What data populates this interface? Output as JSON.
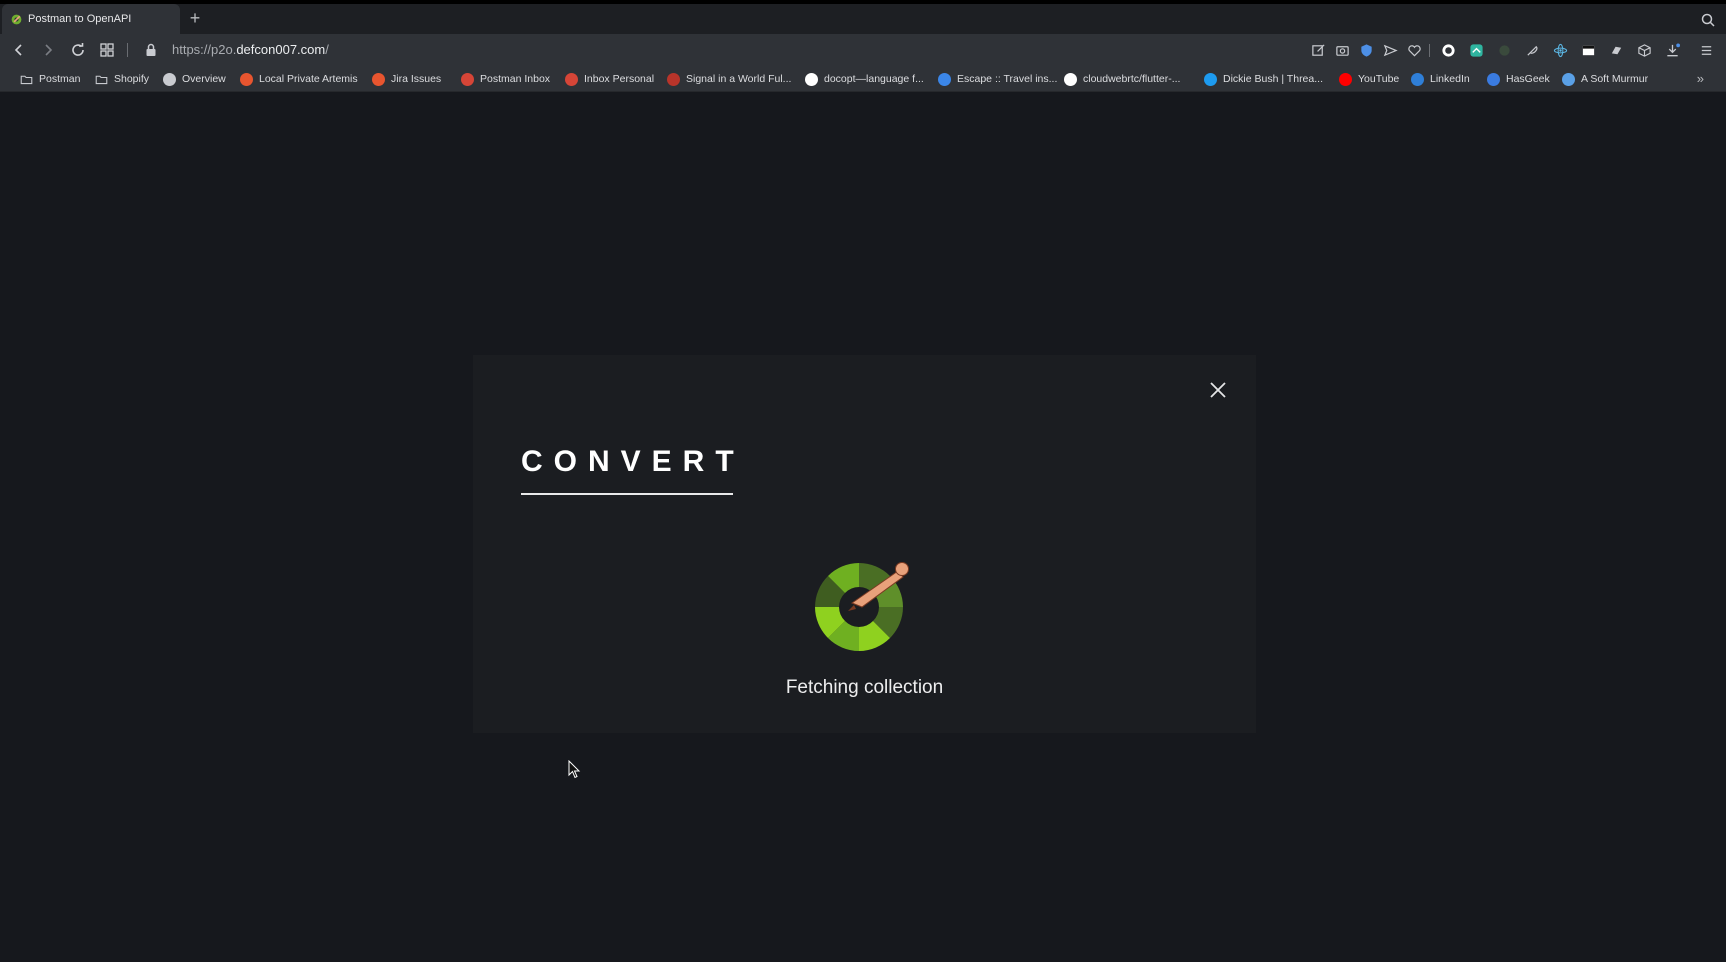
{
  "tab": {
    "title": "Postman to OpenAPI",
    "new_tab_label": "+"
  },
  "address_bar": {
    "url_prefix": "https://p2o.",
    "url_host": "defcon007.com",
    "url_suffix": "/"
  },
  "bookmarks": [
    {
      "label": "Postman",
      "icon": "folder-icon",
      "color": "#c9cbd0"
    },
    {
      "label": "Shopify",
      "icon": "folder-icon",
      "color": "#c9cbd0"
    },
    {
      "label": "Overview",
      "icon": "car-icon",
      "color": "#c9cbd0"
    },
    {
      "label": "Local Private Artemis",
      "icon": "artemis-icon",
      "color": "#e8552f"
    },
    {
      "label": "Jira Issues",
      "icon": "jira-icon",
      "color": "#e8552f"
    },
    {
      "label": "Postman Inbox",
      "icon": "gmail-icon",
      "color": "#d64537"
    },
    {
      "label": "Inbox Personal",
      "icon": "gmail-icon",
      "color": "#d64537"
    },
    {
      "label": "Signal in a World Ful...",
      "icon": "signal-icon",
      "color": "#b8342a"
    },
    {
      "label": "docopt—language f...",
      "icon": "docopt-icon",
      "color": "#ffffff"
    },
    {
      "label": "Escape :: Travel ins...",
      "icon": "escape-icon",
      "color": "#3b86e8"
    },
    {
      "label": "cloudwebrtc/flutter-...",
      "icon": "github-icon",
      "color": "#ffffff"
    },
    {
      "label": "Dickie Bush | Threa...",
      "icon": "twitter-icon",
      "color": "#1d9bf0"
    },
    {
      "label": "YouTube",
      "icon": "youtube-icon",
      "color": "#ff0000"
    },
    {
      "label": "LinkedIn",
      "icon": "linkedin-icon",
      "color": "#2f7fd8"
    },
    {
      "label": "HasGeek",
      "icon": "hasgeek-icon",
      "color": "#3a7be0"
    },
    {
      "label": "A Soft Murmur",
      "icon": "drop-icon",
      "color": "#5aa0e6"
    }
  ],
  "modal": {
    "heading": "CONVERT",
    "status_text": "Fetching collection"
  },
  "colors": {
    "page_background": "#16181d",
    "modal_background": "#1b1d21",
    "logo_green_light": "#8fd11f",
    "logo_green_dark": "#4a6e24",
    "logo_figure": "#e8a17b"
  }
}
